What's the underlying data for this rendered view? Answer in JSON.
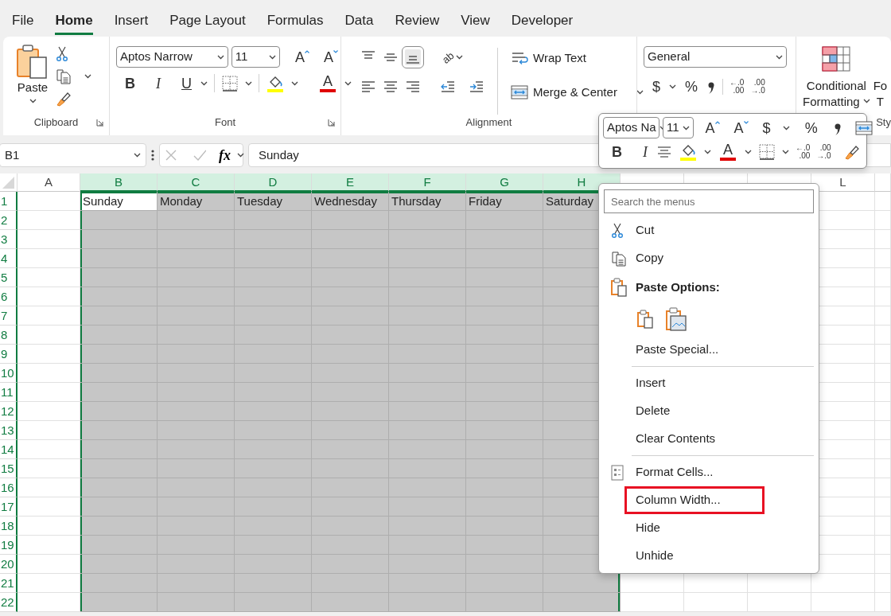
{
  "tabs": [
    {
      "label": "File",
      "selected": false
    },
    {
      "label": "Home",
      "selected": true
    },
    {
      "label": "Insert",
      "selected": false
    },
    {
      "label": "Page Layout",
      "selected": false
    },
    {
      "label": "Formulas",
      "selected": false
    },
    {
      "label": "Data",
      "selected": false
    },
    {
      "label": "Review",
      "selected": false
    },
    {
      "label": "View",
      "selected": false
    },
    {
      "label": "Developer",
      "selected": false
    }
  ],
  "ribbon": {
    "clipboard": {
      "label": "Clipboard",
      "paste": "Paste"
    },
    "font": {
      "label": "Font",
      "font_name": "Aptos Narrow",
      "font_size": "11",
      "grow": "A",
      "shrink": "A",
      "bold": "B",
      "italic": "I",
      "underline": "U",
      "font_color": "A"
    },
    "alignment": {
      "label": "Alignment",
      "vertical": [
        {
          "kind": "top",
          "selected": false
        },
        {
          "kind": "middle",
          "selected": false
        },
        {
          "kind": "bottom",
          "selected": true
        }
      ],
      "horizontal": [
        {
          "kind": "left",
          "selected": false
        },
        {
          "kind": "center",
          "selected": false
        },
        {
          "kind": "right",
          "selected": false
        }
      ],
      "orientation": "ab",
      "wrap_text": "Wrap Text",
      "merge": "Merge & Center"
    },
    "number": {
      "format": "General",
      "currency": "$",
      "percent": "%",
      "decimals": [
        {
          "top": "←.0",
          "bottom": ".00"
        },
        {
          "top": ".00",
          "bottom": "→.0"
        }
      ]
    },
    "styles": {
      "conditional": [
        "Conditional",
        "Formatting"
      ],
      "next_button": [
        "Fo",
        "T"
      ],
      "label": "Sty"
    }
  },
  "formula_bar": {
    "name_box": "B1",
    "fx": "fx",
    "formula": "Sunday"
  },
  "sheet": {
    "columns": [
      {
        "label": "A",
        "selected": false
      },
      {
        "label": "B",
        "selected": true
      },
      {
        "label": "C",
        "selected": true
      },
      {
        "label": "D",
        "selected": true
      },
      {
        "label": "E",
        "selected": true
      },
      {
        "label": "F",
        "selected": true
      },
      {
        "label": "G",
        "selected": true
      },
      {
        "label": "H",
        "selected": true
      },
      {
        "selected": false
      },
      {
        "selected": false
      },
      {
        "selected": false
      },
      {
        "label": "L",
        "selected": false
      }
    ],
    "rows": [
      "1",
      "2",
      "3",
      "4",
      "5",
      "6",
      "7",
      "8",
      "9",
      "10",
      "11",
      "12",
      "13",
      "14",
      "15",
      "16",
      "17",
      "18",
      "19",
      "20",
      "21",
      "22"
    ],
    "first_row": [
      "Sunday",
      "Monday",
      "Tuesday",
      "Wednesday",
      "Thursday",
      "Friday",
      "Saturday"
    ]
  },
  "mini_toolbar": {
    "font_name": "Aptos Na",
    "font_size": "11",
    "grow": "A",
    "shrink": "A",
    "currency": "$",
    "percent": "%",
    "bold": "B",
    "italic": "I",
    "font_color": "A",
    "decimals": [
      {
        "top": "←.0",
        "bottom": ".00"
      },
      {
        "top": ".00",
        "bottom": "→.0"
      }
    ]
  },
  "context_menu": {
    "search_placeholder": "Search the menus",
    "items": [
      {
        "kind": "cut",
        "label": "Cut",
        "annotated": false
      },
      {
        "kind": "copy",
        "label": "Copy",
        "annotated": false
      },
      {
        "kind": "paste-header",
        "label": "Paste Options:"
      },
      {
        "kind": "paste-buttons"
      },
      {
        "kind": "command",
        "label": "Paste Special...",
        "annotated": false
      },
      {
        "kind": "separator"
      },
      {
        "kind": "command",
        "label": "Insert",
        "annotated": false
      },
      {
        "kind": "command",
        "label": "Delete",
        "annotated": false
      },
      {
        "kind": "command",
        "label": "Clear Contents",
        "annotated": false
      },
      {
        "kind": "separator"
      },
      {
        "kind": "format-cells",
        "label": "Format Cells...",
        "annotated": false
      },
      {
        "kind": "command",
        "label": "Column Width...",
        "annotated": true
      },
      {
        "kind": "command",
        "label": "Hide",
        "annotated": false
      },
      {
        "kind": "command",
        "label": "Unhide",
        "annotated": false
      }
    ]
  }
}
